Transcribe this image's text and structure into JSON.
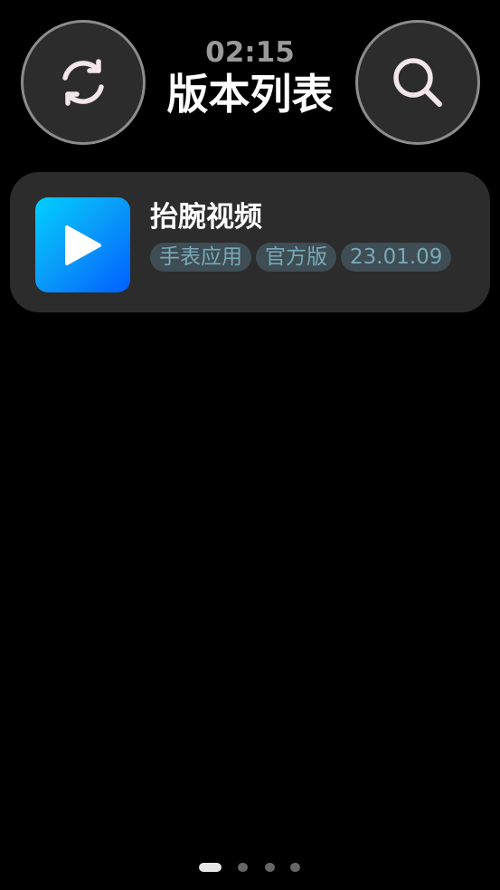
{
  "header": {
    "time": "02:15",
    "title": "版本列表",
    "refresh_icon": "refresh-icon",
    "search_icon": "search-icon"
  },
  "apps": [
    {
      "name": "抬腕视频",
      "icon": "play-icon",
      "tags": [
        "手表应用",
        "官方版",
        "23.01.09"
      ]
    }
  ],
  "pager": {
    "pages": 4,
    "current": 1
  },
  "colors": {
    "background": "#000000",
    "button_fill": "#2c2c2c",
    "button_border": "#8c8c8c",
    "card": "#2c2c2c",
    "tag_bg": "#3f4d54",
    "tag_text": "#77a9b8",
    "icon_gradient_start": "#00cfff",
    "icon_gradient_end": "#005fff"
  }
}
